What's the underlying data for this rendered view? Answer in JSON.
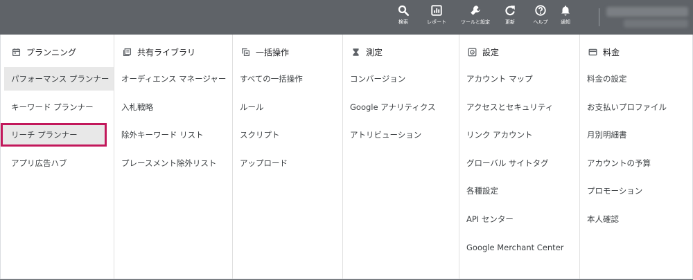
{
  "toolbar": {
    "buttons": [
      {
        "label": "検索",
        "icon": "search-icon"
      },
      {
        "label": "レポート",
        "icon": "report-icon"
      },
      {
        "label": "ツールと設定",
        "icon": "wrench-icon"
      },
      {
        "label": "更新",
        "icon": "refresh-icon"
      },
      {
        "label": "ヘルプ",
        "icon": "help-icon"
      },
      {
        "label": "通知",
        "icon": "bell-icon"
      }
    ]
  },
  "columns": [
    {
      "title": "プランニング",
      "icon": "calendar-icon",
      "items": [
        "パフォーマンス プランナー",
        "キーワード プランナー",
        "リーチ プランナー",
        "アプリ広告ハブ"
      ]
    },
    {
      "title": "共有ライブラリ",
      "icon": "library-icon",
      "items": [
        "オーディエンス マネージャー",
        "入札戦略",
        "除外キーワード リスト",
        "プレースメント除外リスト"
      ]
    },
    {
      "title": "一括操作",
      "icon": "copy-icon",
      "items": [
        "すべての一括操作",
        "ルール",
        "スクリプト",
        "アップロード"
      ]
    },
    {
      "title": "測定",
      "icon": "hourglass-icon",
      "items": [
        "コンバージョン",
        "Google アナリティクス",
        "アトリビューション"
      ]
    },
    {
      "title": "設定",
      "icon": "settings-icon",
      "items": [
        "アカウント マップ",
        "アクセスとセキュリティ",
        "リンク アカウント",
        "グローバル サイトタグ",
        "各種設定",
        "API センター",
        "Google Merchant Center"
      ]
    },
    {
      "title": "料金",
      "icon": "credit-card-icon",
      "items": [
        "料金の設定",
        "お支払いプロファイル",
        "月別明細書",
        "アカウントの予算",
        "プロモーション",
        "本人確認"
      ]
    }
  ],
  "state": {
    "hovered_item": "パフォーマンス プランナー",
    "highlighted_item": "リーチ プランナー",
    "highlight_color": "#c2185b"
  }
}
